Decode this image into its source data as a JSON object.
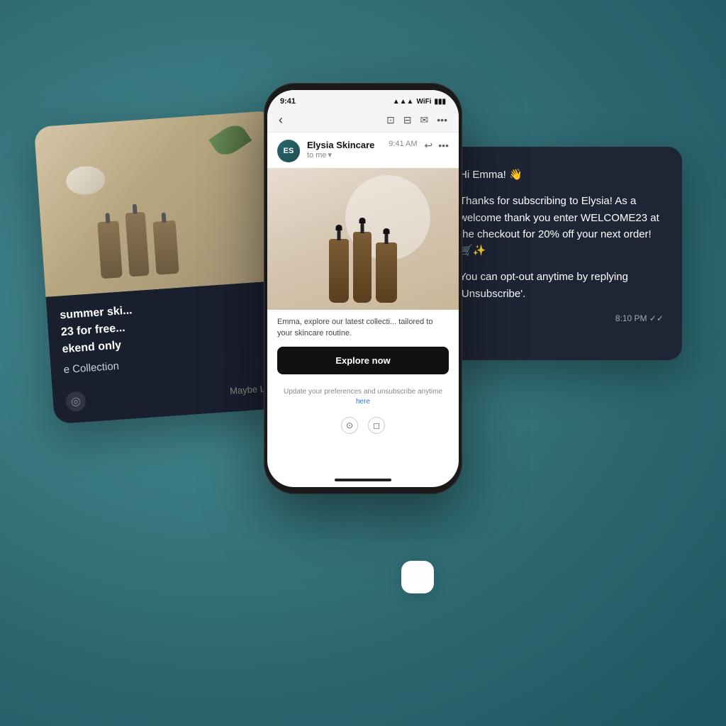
{
  "scene": {
    "background_color": "#3d7a80"
  },
  "phone": {
    "status_bar": {
      "time": "9:41",
      "signal_icon": "📶",
      "wifi_icon": "WiFi",
      "battery_icon": "🔋"
    },
    "email": {
      "sender": "Elysia Skincare",
      "sender_initials": "ES",
      "time": "9:41 AM",
      "to": "to me",
      "body_text": "Emma, explore our latest collecti... tailored to your skincare routine.",
      "explore_button": "Explore now",
      "footer_text": "Update your preferences and unsubscribe anytime",
      "footer_link": "here"
    }
  },
  "sms_card": {
    "greeting": "Hi Emma! 👋",
    "message_line1": "Thanks for subscribing to Elysia! As a welcome thank you enter WELCOME23 at the checkout for 20% off your next order! 🛒✨",
    "message_line2": "You can opt-out anytime by replying 'Unsubscribe'.",
    "time": "8:10 PM ✓✓"
  },
  "photo_card": {
    "promo_text": "summer ski... 23 for free... ekend only",
    "collection_label": "e Collection",
    "maybe_later": "Maybe Later"
  },
  "decorative": {
    "square1": "",
    "square2": ""
  }
}
